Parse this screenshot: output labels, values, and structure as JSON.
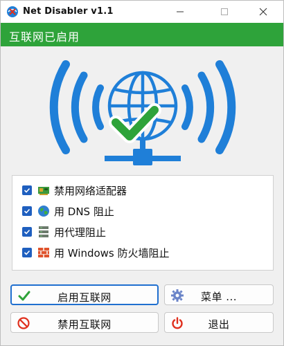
{
  "window": {
    "title": "Net Disabler v1.1"
  },
  "status": {
    "text": "互联网已启用",
    "color": "#2ea33a"
  },
  "options": [
    {
      "label": "禁用网络适配器",
      "checked": true,
      "icon": "network-adapter-icon"
    },
    {
      "label": "用 DNS 阻止",
      "checked": true,
      "icon": "globe-icon"
    },
    {
      "label": "用代理阻止",
      "checked": true,
      "icon": "proxy-server-icon"
    },
    {
      "label": "用 Windows 防火墙阻止",
      "checked": true,
      "icon": "firewall-icon"
    }
  ],
  "buttons": {
    "enable": "启用互联网",
    "menu": "菜单 ...",
    "disable": "禁用互联网",
    "exit": "退出"
  },
  "colors": {
    "accent_blue": "#1f7fd8",
    "check_green": "#2ea33a",
    "exit_red": "#e0301e"
  }
}
